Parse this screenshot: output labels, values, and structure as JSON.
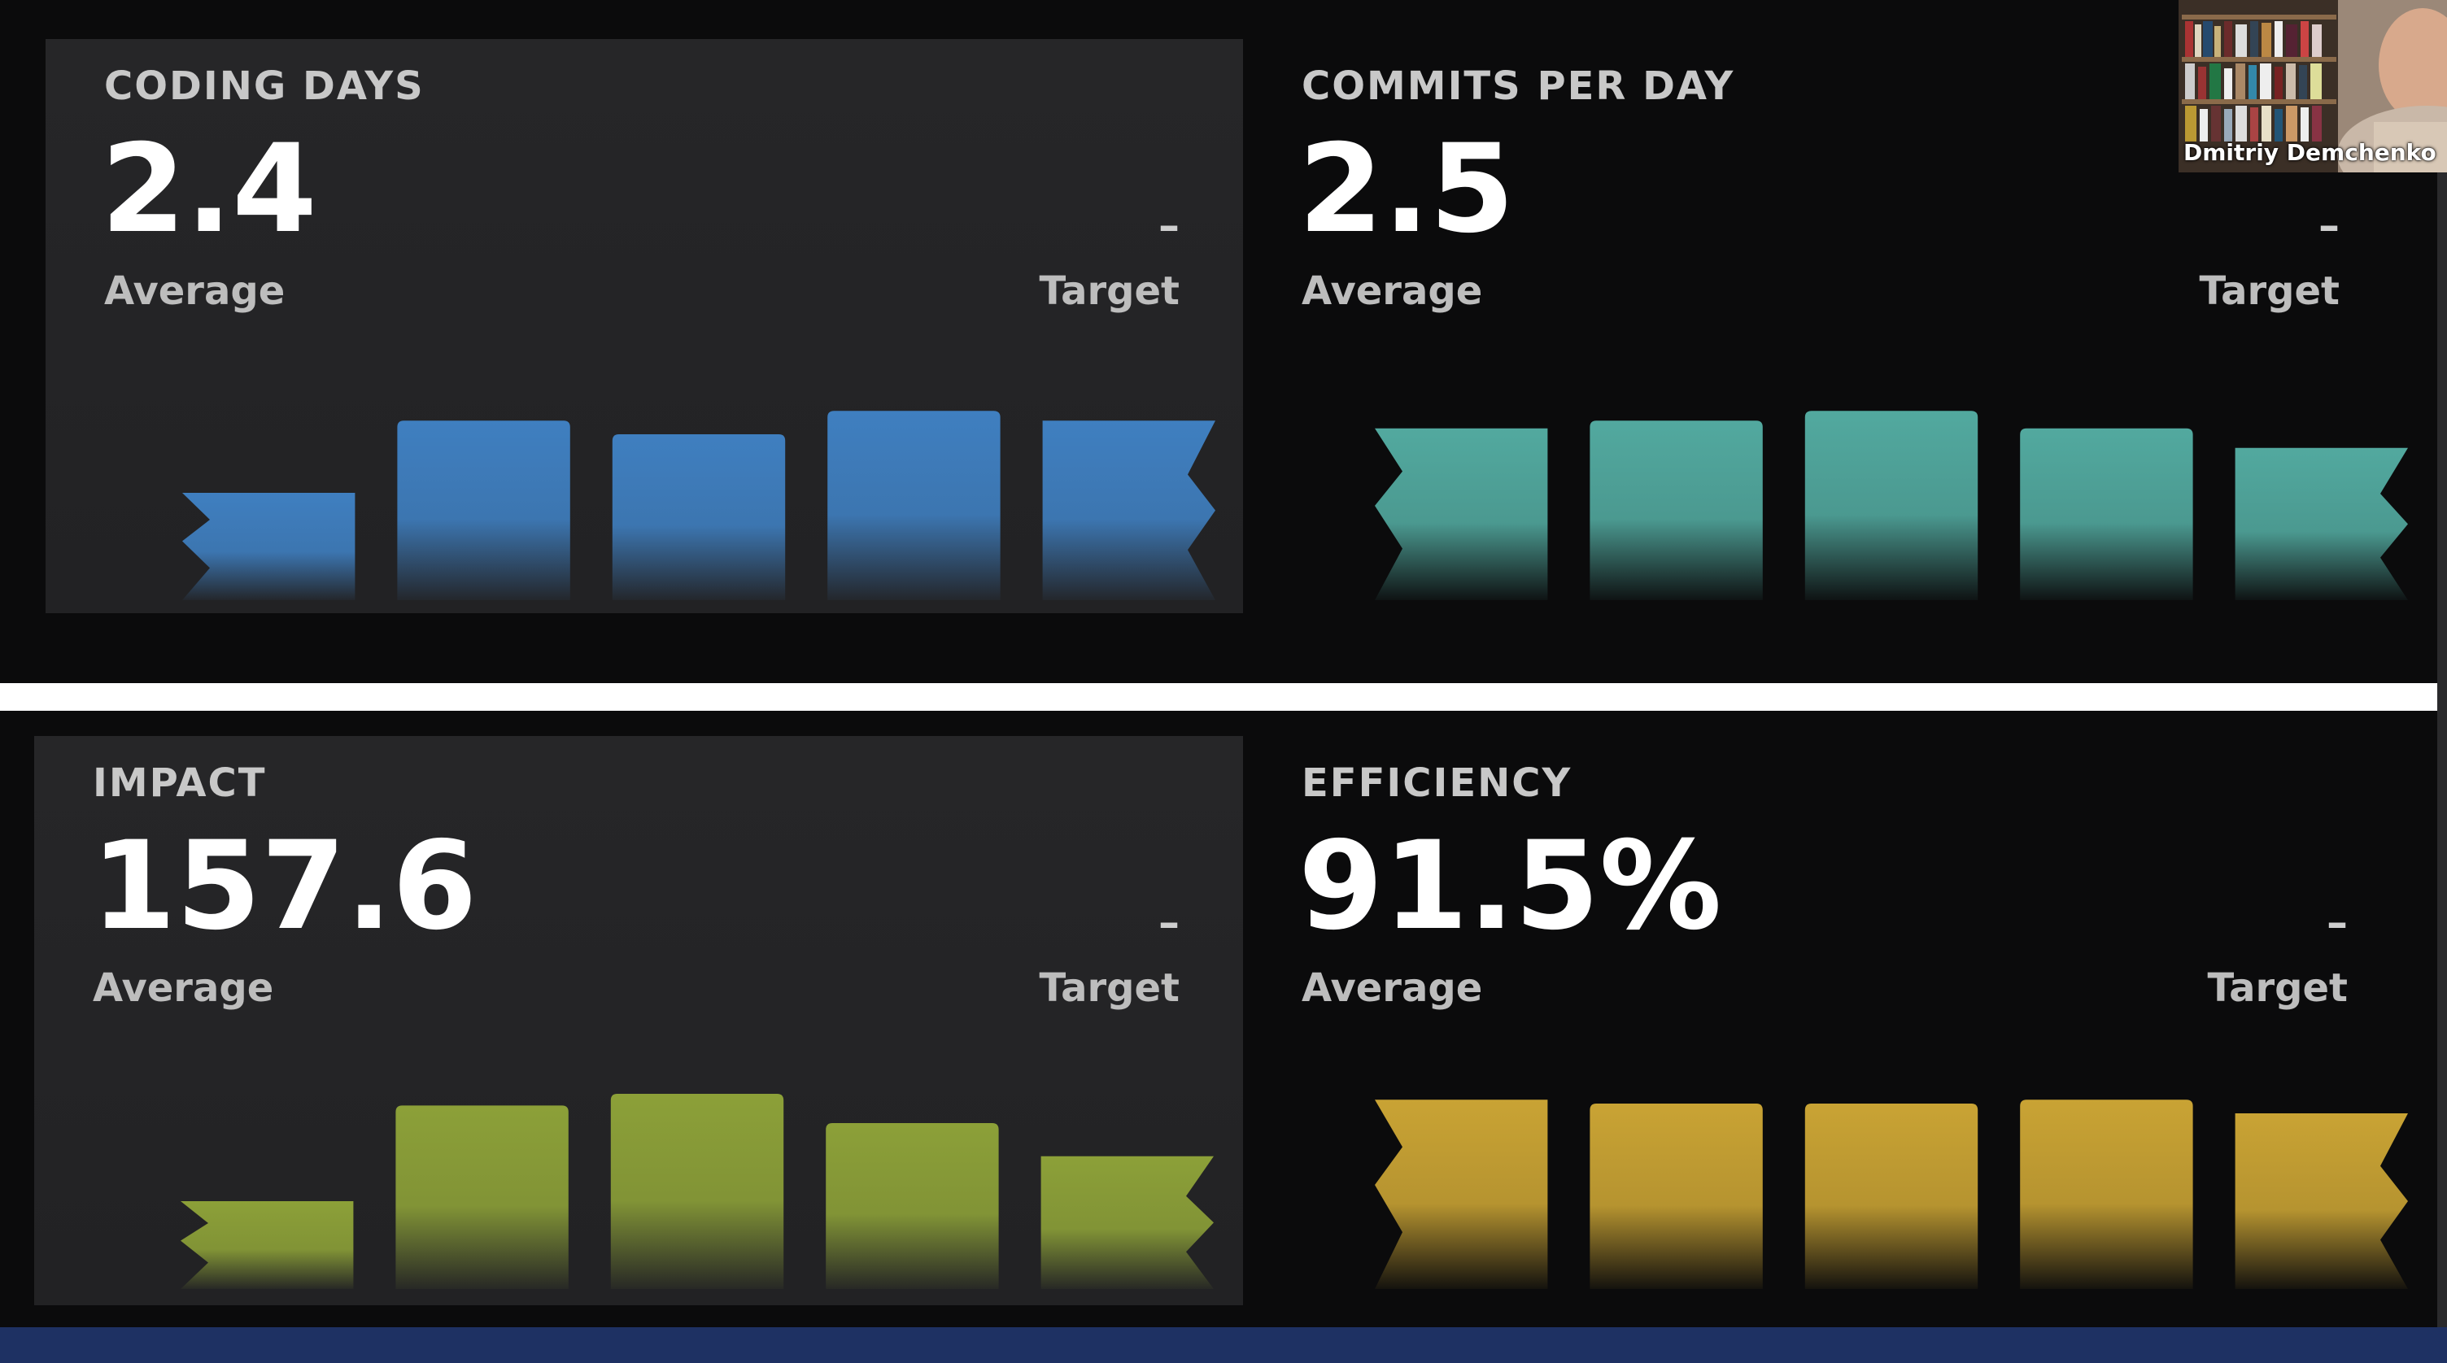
{
  "panels": [
    {
      "id": "coding-days",
      "title": "CODING DAYS",
      "value": "2.4",
      "average_label": "Average",
      "target_value": "–",
      "target_label": "Target",
      "color": "#3f7fc0",
      "bar_levels": [
        0.55,
        0.92,
        0.85,
        0.97,
        0.92
      ]
    },
    {
      "id": "commits-per-day",
      "title": "COMMITS PER DAY",
      "value": "2.5",
      "average_label": "Average",
      "target_value": "–",
      "target_label": "Target",
      "color": "#52a99f",
      "bar_levels": [
        0.88,
        0.92,
        0.97,
        0.88,
        0.78
      ]
    },
    {
      "id": "impact",
      "title": "IMPACT",
      "value": "157.6",
      "average_label": "Average",
      "target_value": "–",
      "target_label": "Target",
      "color": "#8ca038",
      "bar_levels": [
        0.45,
        0.94,
        1.0,
        0.85,
        0.68
      ]
    },
    {
      "id": "efficiency",
      "title": "EFFICIENCY",
      "value": "91.5%",
      "average_label": "Average",
      "target_value": "–",
      "target_label": "Target",
      "color": "#c9a334",
      "bar_levels": [
        0.97,
        0.95,
        0.95,
        0.97,
        0.9
      ]
    }
  ],
  "webcam": {
    "participant_name": "Dmitriy Demchenko"
  }
}
